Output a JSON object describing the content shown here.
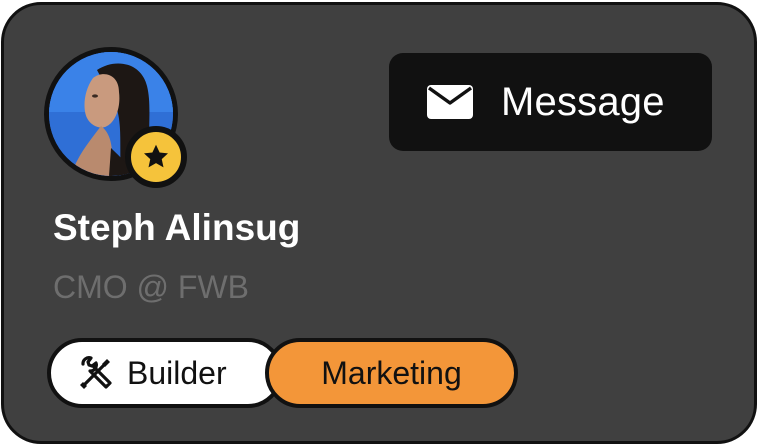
{
  "profile": {
    "name": "Steph Alinsug",
    "role": "CMO @ FWB",
    "avatar_icon": "profile-photo",
    "badge_icon": "star-icon"
  },
  "actions": {
    "message_label": "Message",
    "message_icon": "envelope-icon"
  },
  "tags": [
    {
      "label": "Builder",
      "icon": "tools-icon",
      "color": "#ffffff"
    },
    {
      "label": "Marketing",
      "color": "#f39639"
    }
  ],
  "colors": {
    "card_background": "#404040",
    "border": "#111111",
    "badge": "#f5c33b",
    "accent": "#f39639",
    "muted_text": "#6e6e6e"
  }
}
